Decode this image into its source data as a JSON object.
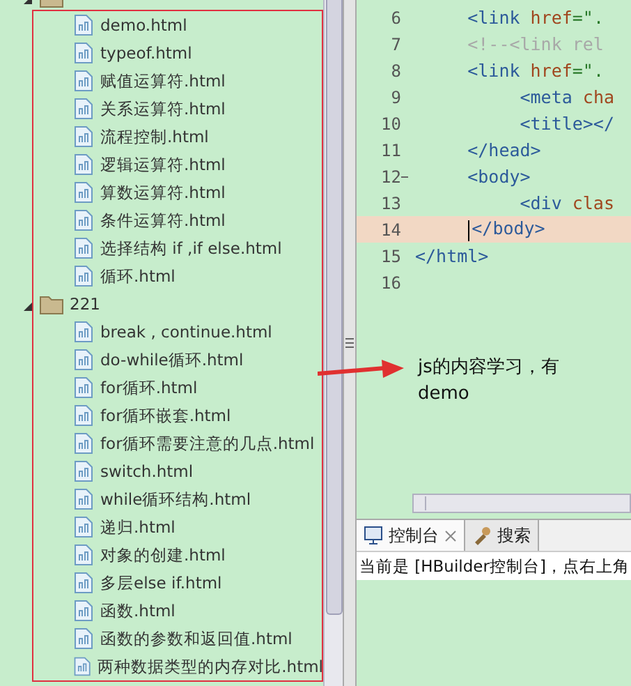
{
  "tree": [
    {
      "expanded": true,
      "children": [
        {
          "label": "demo.html"
        },
        {
          "label": "typeof.html"
        },
        {
          "label": "赋值运算符.html"
        },
        {
          "label": "关系运算符.html"
        },
        {
          "label": "流程控制.html"
        },
        {
          "label": "逻辑运算符.html"
        },
        {
          "label": "算数运算符.html"
        },
        {
          "label": "条件运算符.html"
        },
        {
          "label": "选择结构 if ,if else.html"
        },
        {
          "label": "循环.html"
        }
      ]
    },
    {
      "label": "221",
      "expanded": true,
      "children": [
        {
          "label": "break , continue.html"
        },
        {
          "label": "do-while循环.html"
        },
        {
          "label": "for循环.html"
        },
        {
          "label": "for循环嵌套.html"
        },
        {
          "label": "for循环需要注意的几点.html"
        },
        {
          "label": "switch.html"
        },
        {
          "label": "while循环结构.html"
        },
        {
          "label": "递归.html"
        },
        {
          "label": "对象的创建.html"
        },
        {
          "label": "多层else if.html"
        },
        {
          "label": "函数.html"
        },
        {
          "label": "函数的参数和返回值.html"
        },
        {
          "label": "两种数据类型的内存对比.html"
        }
      ]
    }
  ],
  "editor": {
    "lines": [
      {
        "number": "6",
        "foldable": false,
        "current": false,
        "tokens": [
          {
            "kind": "tag",
            "text": "     <link"
          },
          {
            "kind": "attr",
            "text": " href"
          },
          {
            "kind": "str",
            "text": "=\"."
          }
        ]
      },
      {
        "number": "7",
        "foldable": false,
        "current": false,
        "tokens": [
          {
            "kind": "comment",
            "text": "     <!--<link rel"
          }
        ]
      },
      {
        "number": "8",
        "foldable": false,
        "current": false,
        "tokens": [
          {
            "kind": "tag",
            "text": "     <link"
          },
          {
            "kind": "attr",
            "text": " href"
          },
          {
            "kind": "str",
            "text": "=\"."
          }
        ]
      },
      {
        "number": "9",
        "foldable": false,
        "current": false,
        "tokens": [
          {
            "kind": "tag",
            "text": "          <meta"
          },
          {
            "kind": "attr",
            "text": " cha"
          }
        ]
      },
      {
        "number": "10",
        "foldable": false,
        "current": false,
        "tokens": [
          {
            "kind": "tag",
            "text": "          <title></"
          }
        ]
      },
      {
        "number": "11",
        "foldable": false,
        "current": false,
        "tokens": [
          {
            "kind": "tag",
            "text": "     </head>"
          }
        ]
      },
      {
        "number": "12",
        "foldable": true,
        "current": false,
        "tokens": [
          {
            "kind": "tag",
            "text": "     <body>"
          }
        ]
      },
      {
        "number": "13",
        "foldable": false,
        "current": false,
        "tokens": [
          {
            "kind": "tag",
            "text": "          <div"
          },
          {
            "kind": "attr",
            "text": " clas"
          }
        ]
      },
      {
        "number": "14",
        "foldable": false,
        "current": true,
        "tokens": [
          {
            "kind": "tag",
            "text": "     </body>"
          }
        ]
      },
      {
        "number": "15",
        "foldable": false,
        "current": false,
        "tokens": [
          {
            "kind": "tag",
            "text": "</html>"
          }
        ]
      },
      {
        "number": "16",
        "foldable": false,
        "current": false
      }
    ]
  },
  "console": {
    "tabs": [
      {
        "label": "控制台",
        "selected": true,
        "closable": true
      },
      {
        "label": "搜索",
        "selected": false,
        "closable": false
      }
    ],
    "text": "当前是 [HBuilder控制台]，点右上角"
  },
  "annotation": {
    "text": "js的内容学习，有 demo"
  }
}
